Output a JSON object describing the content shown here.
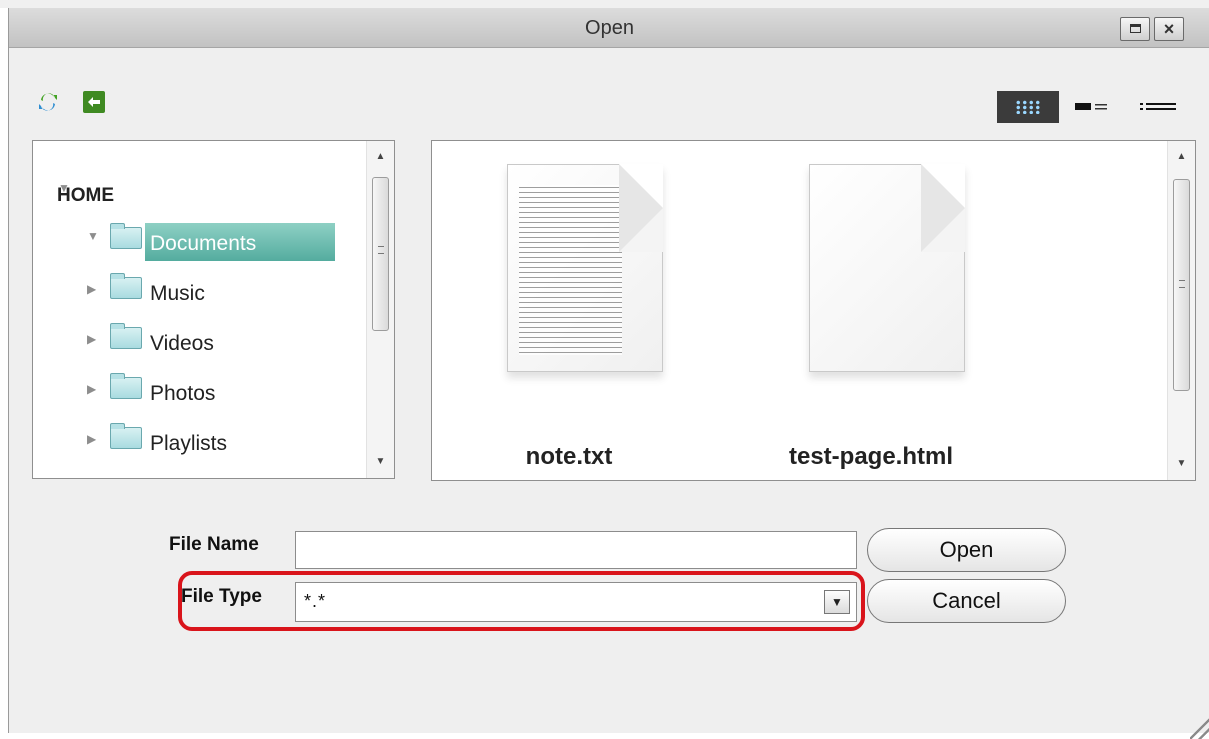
{
  "window": {
    "title": "Open"
  },
  "toolbar": {
    "refresh_icon": "refresh-icon",
    "back_icon": "back-icon",
    "views": [
      "icon-view",
      "list-view",
      "detail-view"
    ],
    "active_view": "icon-view"
  },
  "tree": {
    "root": "HOME",
    "items": [
      {
        "label": "Documents",
        "selected": true,
        "expanded": true
      },
      {
        "label": "Music"
      },
      {
        "label": "Videos"
      },
      {
        "label": "Photos"
      },
      {
        "label": "Playlists"
      }
    ]
  },
  "files": [
    {
      "name": "note.txt",
      "icon": "text-document-icon"
    },
    {
      "name": "test-page.html",
      "icon": "blank-document-icon"
    }
  ],
  "form": {
    "file_name_label": "File Name",
    "file_name_value": "",
    "file_type_label": "File Type",
    "file_type_value": "*.*"
  },
  "buttons": {
    "open": "Open",
    "cancel": "Cancel"
  },
  "colors": {
    "highlight": "#d9141b",
    "selection": "#5fb3a7",
    "toolbar_active": "#3b3b3b",
    "back_button": "#3f8a22"
  }
}
